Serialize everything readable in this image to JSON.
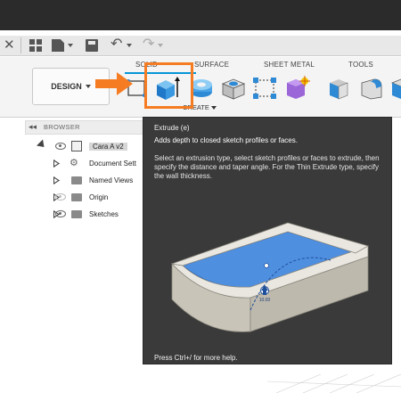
{
  "qat": {
    "close_icon": "close-icon",
    "icons": [
      "grid-icon",
      "file-icon",
      "save-icon",
      "undo-icon",
      "redo-icon"
    ]
  },
  "toolbar": {
    "workspace_label": "DESIGN",
    "tabs": [
      {
        "label": "SOLID",
        "active": true
      },
      {
        "label": "SURFACE",
        "active": false
      },
      {
        "label": "SHEET METAL",
        "active": false
      },
      {
        "label": "TOOLS",
        "active": false
      }
    ],
    "group_label": "CREATE",
    "accent_color": "#0696d7",
    "highlight_color": "#f57c22"
  },
  "browser": {
    "title": "BROWSER",
    "items": [
      {
        "label": "Cara A v2",
        "type": "component"
      },
      {
        "label": "Document Sett",
        "type": "settings"
      },
      {
        "label": "Named Views",
        "type": "folder"
      },
      {
        "label": "Origin",
        "type": "folder"
      },
      {
        "label": "Sketches",
        "type": "folder"
      }
    ]
  },
  "tooltip": {
    "title": "Extrude (e)",
    "summary": "Adds depth to closed sketch profiles or faces.",
    "description": "Select an extrusion type, select sketch profiles or faces to extrude, then specify the distance and taper angle. For the Thin Extrude type, specify the wall thickness.",
    "illustration_value": "10.00",
    "footer": "Press Ctrl+/ for more help."
  }
}
